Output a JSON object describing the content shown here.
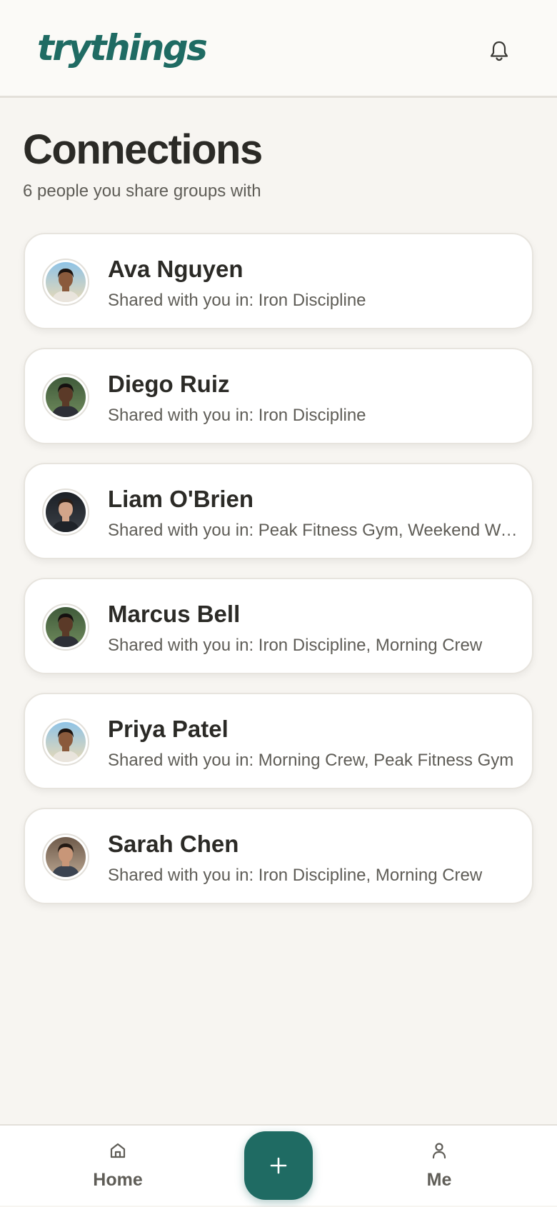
{
  "app": {
    "logo_text": "trythings",
    "brand_color": "#1f6b63"
  },
  "header": {
    "notification_icon": "bell-icon"
  },
  "page": {
    "title": "Connections",
    "subtitle": "6 people you share groups with"
  },
  "connections": [
    {
      "name": "Ava Nguyen",
      "shared": "Shared with you in: Iron Discipline",
      "avatar": "photo-beach"
    },
    {
      "name": "Diego Ruiz",
      "shared": "Shared with you in: Iron Discipline",
      "avatar": "photo-forest"
    },
    {
      "name": "Liam O'Brien",
      "shared": "Shared with you in: Peak Fitness Gym, Weekend Warriors",
      "avatar": "photo-dark"
    },
    {
      "name": "Marcus Bell",
      "shared": "Shared with you in: Iron Discipline, Morning Crew",
      "avatar": "photo-forest"
    },
    {
      "name": "Priya Patel",
      "shared": "Shared with you in: Morning Crew, Peak Fitness Gym",
      "avatar": "photo-beach"
    },
    {
      "name": "Sarah Chen",
      "shared": "Shared with you in: Iron Discipline, Morning Crew",
      "avatar": "photo-office"
    }
  ],
  "nav": {
    "home_label": "Home",
    "me_label": "Me",
    "home_icon": "home-icon",
    "me_icon": "person-icon",
    "add_icon": "plus-icon"
  }
}
